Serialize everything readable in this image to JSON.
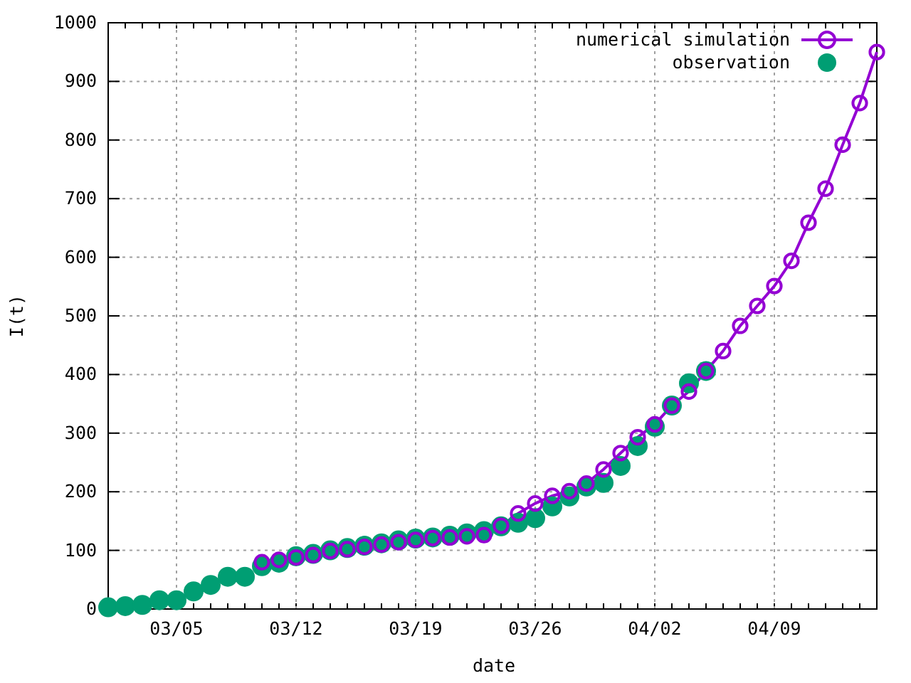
{
  "chart": {
    "chart_data": {
      "type": "line",
      "xlabel": "date",
      "ylabel": "I(t)",
      "categories": [
        null,
        null,
        null,
        null,
        "03/05",
        null,
        null,
        null,
        null,
        null,
        null,
        "03/12",
        null,
        null,
        null,
        null,
        null,
        null,
        "03/19",
        null,
        null,
        null,
        null,
        null,
        null,
        "03/26",
        null,
        null,
        null,
        null,
        null,
        null,
        "04/02",
        null,
        null,
        null,
        null,
        null,
        null,
        "04/09",
        null,
        null,
        null,
        null,
        null,
        null
      ],
      "series": [
        {
          "name": "numerical simulation",
          "color": "#9400d3",
          "marker": "open-circle",
          "values": [
            null,
            null,
            null,
            null,
            null,
            null,
            null,
            null,
            null,
            80,
            84,
            88,
            92,
            99,
            102,
            106,
            110,
            114,
            118,
            121,
            122,
            124,
            126,
            142,
            163,
            180,
            193,
            201,
            214,
            238,
            266,
            293,
            315,
            347,
            371,
            406,
            440,
            483,
            517,
            551,
            594,
            659,
            717,
            792,
            863,
            950
          ]
        },
        {
          "name": "observation",
          "color": "#009e73",
          "marker": "filled-circle",
          "type": "scatter",
          "values": [
            3,
            5,
            7,
            15,
            15,
            30,
            41,
            55,
            55,
            73,
            79,
            90,
            94,
            100,
            104,
            108,
            112,
            117,
            120,
            122,
            125,
            129,
            133,
            141,
            147,
            155,
            175,
            192,
            209,
            215,
            244,
            278,
            311,
            347,
            385,
            406,
            null,
            null,
            null,
            null,
            null,
            null,
            null,
            null,
            null,
            null
          ]
        }
      ],
      "ylim": [
        0,
        1000
      ],
      "yticks": [
        0,
        100,
        200,
        300,
        400,
        500,
        600,
        700,
        800,
        900,
        1000
      ],
      "grid": true,
      "legend": true
    }
  }
}
